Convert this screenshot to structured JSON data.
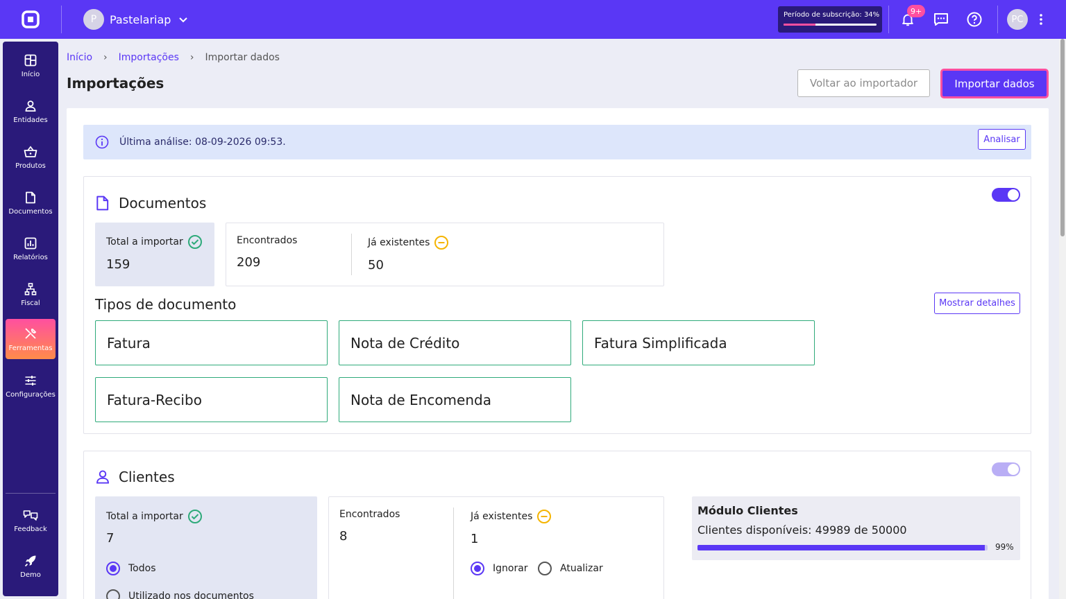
{
  "header": {
    "company_initial": "P",
    "company_name": "Pastelariap",
    "subscription_label": "Período de subscrição: 34%",
    "subscription_progress": 0.34,
    "notification_badge": "9+",
    "user_initials": "PC"
  },
  "sidebar": {
    "items": [
      {
        "label": "Início",
        "icon": "dashboard-icon"
      },
      {
        "label": "Entidades",
        "icon": "user-icon"
      },
      {
        "label": "Produtos",
        "icon": "basket-icon"
      },
      {
        "label": "Documentos",
        "icon": "document-icon"
      },
      {
        "label": "Relatórios",
        "icon": "chart-icon"
      },
      {
        "label": "Fiscal",
        "icon": "hierarchy-icon"
      },
      {
        "label": "Ferramentas",
        "icon": "tools-icon"
      },
      {
        "label": "Configurações",
        "icon": "sliders-icon"
      }
    ],
    "bottom": [
      {
        "label": "Feedback",
        "icon": "feedback-icon"
      },
      {
        "label": "Demo",
        "icon": "rocket-icon"
      }
    ],
    "active": "Ferramentas"
  },
  "breadcrumb": {
    "home": "Início",
    "imports": "Importações",
    "current": "Importar dados"
  },
  "page": {
    "title": "Importações",
    "back_button": "Voltar ao importador",
    "import_button": "Importar dados"
  },
  "banner": {
    "text": "Última análise: 08-09-2026 09:53.",
    "analyze_button": "Analisar"
  },
  "documents": {
    "title": "Documentos",
    "enabled": true,
    "total_label": "Total a importar",
    "total_value": "159",
    "found_label": "Encontrados",
    "found_value": "209",
    "existing_label": "Já existentes",
    "existing_value": "50",
    "types_title": "Tipos de documento",
    "details_button": "Mostrar detalhes",
    "types": [
      "Fatura",
      "Nota de Crédito",
      "Fatura Simplificada",
      "Fatura-Recibo",
      "Nota de Encomenda"
    ]
  },
  "clients": {
    "title": "Clientes",
    "enabled": false,
    "total_label": "Total a importar",
    "total_value": "7",
    "found_label": "Encontrados",
    "found_value": "8",
    "existing_label": "Já existentes",
    "existing_value": "1",
    "option_all": "Todos",
    "option_used": "Utilizado nos documentos",
    "option_ignore": "Ignorar",
    "option_update": "Atualizar",
    "module_title": "Módulo Clientes",
    "module_text": "Clientes disponíveis: 49989 de 50000",
    "module_progress": 0.99,
    "module_pct": "99%"
  },
  "colors": {
    "brand": "#5a37f5",
    "sidebar": "#2a1a7a",
    "accent": "#ff4fa0",
    "success": "#2eaa7a",
    "warning": "#f5b400"
  }
}
